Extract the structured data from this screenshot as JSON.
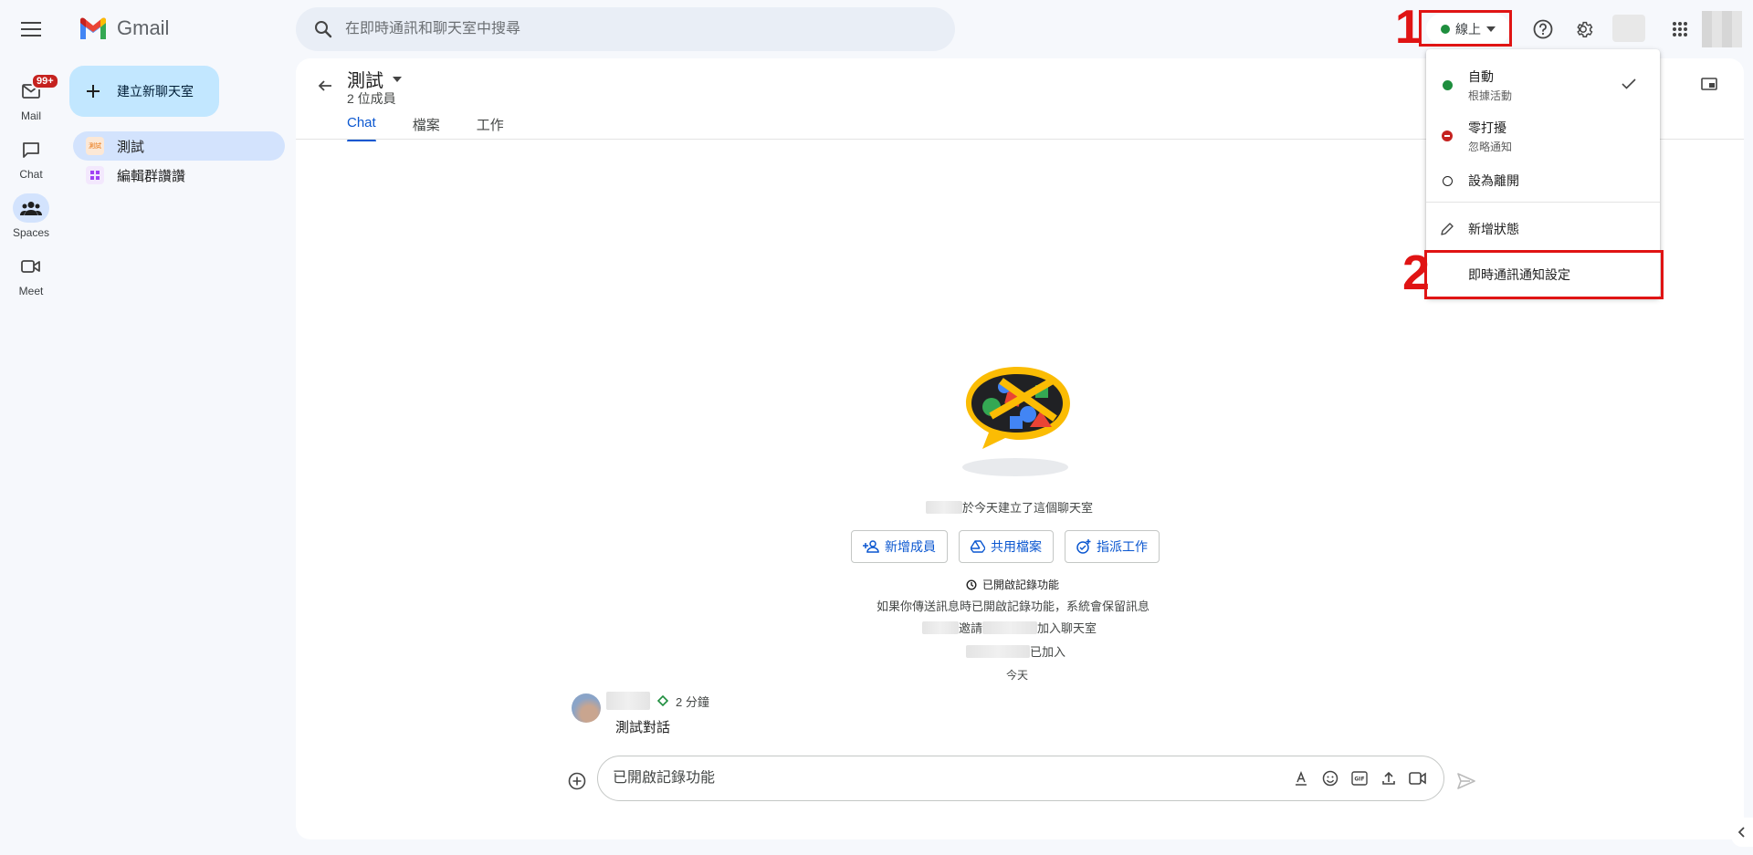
{
  "app": {
    "logo_text": "Gmail"
  },
  "search": {
    "placeholder": "在即時通訊和聊天室中搜尋"
  },
  "status": {
    "current": "線上",
    "color": "#1e8e3e"
  },
  "rail": {
    "mail": {
      "label": "Mail",
      "badge": "99+"
    },
    "chat": {
      "label": "Chat"
    },
    "spaces": {
      "label": "Spaces"
    },
    "meet": {
      "label": "Meet"
    }
  },
  "side": {
    "new_chat_label": "建立新聊天室",
    "spaces": [
      {
        "name": "測試",
        "avatar_text": "測試",
        "avatar_color": "#f4a261"
      },
      {
        "name": "編輯群讚讚",
        "avatar_color": "#a142f4"
      }
    ]
  },
  "room": {
    "title": "測試",
    "members": "2 位成員",
    "tabs": [
      "Chat",
      "檔案",
      "工作"
    ]
  },
  "timeline": {
    "created_suffix": "於今天建立了這個聊天室",
    "actions": [
      "新增成員",
      "共用檔案",
      "指派工作"
    ],
    "history_title": "已開啟記錄功能",
    "history_desc": "如果你傳送訊息時已開啟記錄功能，系統會保留訊息",
    "invite_mid": "邀請",
    "invite_end": "加入聊天室",
    "joined": "已加入",
    "date_separator": "今天"
  },
  "message": {
    "time": "2 分鐘",
    "text": "測試對話"
  },
  "compose": {
    "placeholder": "已開啟記錄功能"
  },
  "status_menu": {
    "items": [
      {
        "label": "自動",
        "sub": "根據活動"
      },
      {
        "label": "零打擾",
        "sub": "忽略通知"
      },
      {
        "label": "設為離開"
      }
    ],
    "add_status": "新增狀態",
    "notification_settings": "即時通訊通知設定"
  },
  "annotations": {
    "step1": "1",
    "step2": "2",
    "color": "#e01414"
  }
}
